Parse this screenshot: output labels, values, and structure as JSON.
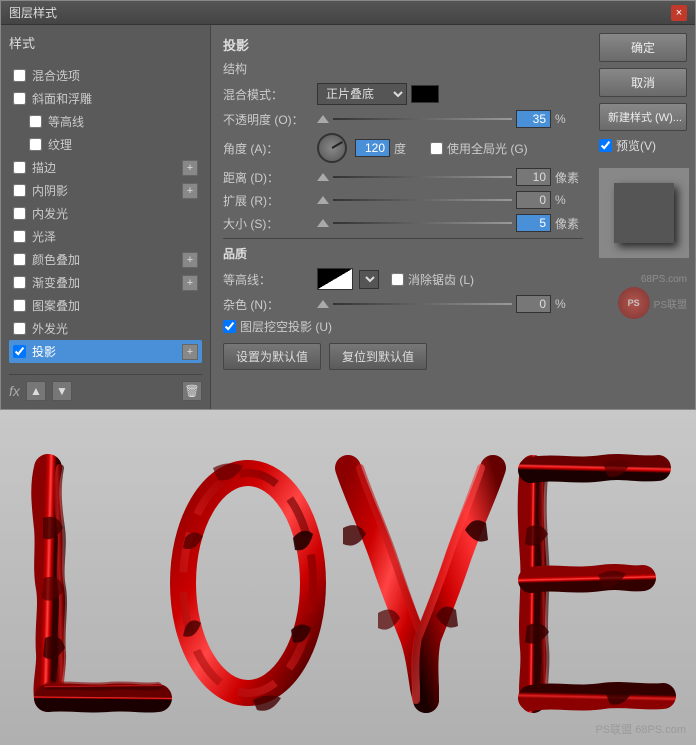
{
  "dialog": {
    "title": "图层样式",
    "close_label": "×"
  },
  "buttons": {
    "ok": "确定",
    "cancel": "取消",
    "new_style": "新建样式 (W)...",
    "preview_label": "预览(V)"
  },
  "styles_panel": {
    "title": "样式",
    "items": [
      {
        "id": "blending",
        "label": "混合选项",
        "checked": false,
        "has_plus": false
      },
      {
        "id": "bevel",
        "label": "斜面和浮雕",
        "checked": false,
        "has_plus": false
      },
      {
        "id": "contour",
        "label": "等高线",
        "checked": false,
        "has_plus": false,
        "indent": true
      },
      {
        "id": "texture",
        "label": "纹理",
        "checked": false,
        "has_plus": false,
        "indent": true
      },
      {
        "id": "stroke",
        "label": "描边",
        "checked": false,
        "has_plus": true
      },
      {
        "id": "inner_shadow",
        "label": "内阴影",
        "checked": false,
        "has_plus": true
      },
      {
        "id": "inner_glow",
        "label": "内发光",
        "checked": false,
        "has_plus": false
      },
      {
        "id": "satin",
        "label": "光泽",
        "checked": false,
        "has_plus": false
      },
      {
        "id": "color_overlay",
        "label": "颜色叠加",
        "checked": false,
        "has_plus": true
      },
      {
        "id": "gradient_overlay",
        "label": "渐变叠加",
        "checked": false,
        "has_plus": true
      },
      {
        "id": "pattern_overlay",
        "label": "图案叠加",
        "checked": false,
        "has_plus": false
      },
      {
        "id": "outer_glow",
        "label": "外发光",
        "checked": false,
        "has_plus": false
      },
      {
        "id": "drop_shadow",
        "label": "投影",
        "checked": true,
        "has_plus": true,
        "active": true
      }
    ],
    "fx_label": "fx",
    "up_label": "▲",
    "down_label": "▼",
    "delete_label": "🗑"
  },
  "drop_shadow": {
    "section_title": "投影",
    "struct_title": "结构",
    "blend_mode_label": "混合模式：",
    "blend_mode_value": "正片叠底",
    "opacity_label": "不透明度 (O)：",
    "opacity_value": "35",
    "opacity_unit": "%",
    "angle_label": "角度 (A)：",
    "angle_value": "120",
    "angle_unit": "度",
    "global_light_label": "使用全局光 (G)",
    "distance_label": "距离 (D)：",
    "distance_value": "10",
    "distance_unit": "像素",
    "spread_label": "扩展 (R)：",
    "spread_value": "0",
    "spread_unit": "%",
    "size_label": "大小 (S)：",
    "size_value": "5",
    "size_unit": "像素",
    "quality_title": "品质",
    "contour_label": "等高线：",
    "anti_alias_label": "消除锯齿 (L)",
    "noise_label": "杂色 (N)：",
    "noise_value": "0",
    "noise_unit": "%",
    "knockout_label": "图层挖空投影 (U)",
    "set_default_label": "设置为默认值",
    "reset_default_label": "复位到默认值"
  },
  "canvas": {
    "watermark": "PS联盟 68PS.com",
    "love_text": "LOVE"
  }
}
